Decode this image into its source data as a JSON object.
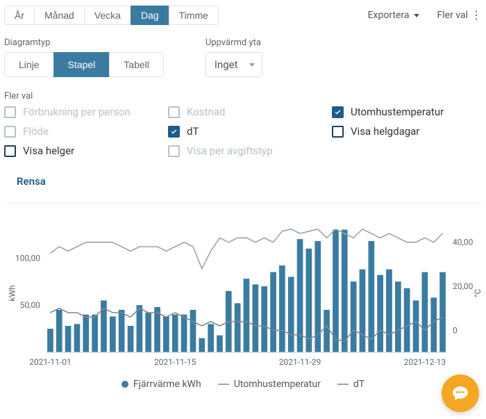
{
  "period_tabs": {
    "items": [
      "År",
      "Månad",
      "Vecka",
      "Dag",
      "Timme"
    ],
    "active": "Dag"
  },
  "actions": {
    "export": "Exportera",
    "more": "Fler val"
  },
  "chart_type": {
    "label": "Diagramtyp",
    "items": [
      "Linje",
      "Stapel",
      "Tabell"
    ],
    "active": "Stapel"
  },
  "heated_area": {
    "label": "Uppvärmd yta",
    "value": "Inget"
  },
  "more_options": {
    "label": "Fler val",
    "items": [
      {
        "label": "Förbrukning per person",
        "checked": false,
        "disabled": true
      },
      {
        "label": "Kostnad",
        "checked": false,
        "disabled": true
      },
      {
        "label": "Utomhustemperatur",
        "checked": true,
        "disabled": false
      },
      {
        "label": "Flöde",
        "checked": false,
        "disabled": true
      },
      {
        "label": "dT",
        "checked": true,
        "disabled": false
      },
      {
        "label": "Visa helgdagar",
        "checked": false,
        "disabled": false
      },
      {
        "label": "Visa helger",
        "checked": false,
        "disabled": false
      },
      {
        "label": "Visa per avgiftstyp",
        "checked": false,
        "disabled": true
      }
    ]
  },
  "clear": "Rensa",
  "axes": {
    "left_label": "kWh",
    "right_label": "°C",
    "left_ticks": [
      "50,00",
      "100,00"
    ],
    "right_ticks": [
      "0",
      "20,00",
      "40,00"
    ],
    "x_ticks": [
      "2021-11-01",
      "2021-11-15",
      "2021-11-29",
      "2021-12-13"
    ]
  },
  "legend": {
    "bar": "Fjärrvärme kWh",
    "line1": "Utomhustemperatur",
    "line2": "dT"
  },
  "colors": {
    "bar": "#3b7ba1",
    "line_light": "#9aa4ab",
    "line_mid": "#7d878e",
    "accent": "#1f5c8b",
    "fab": "#f5a623"
  },
  "chart_data": {
    "type": "bar",
    "title": "",
    "xlabel": "",
    "ylabel_left": "kWh",
    "ylabel_right": "°C",
    "ylim_left": [
      0,
      140
    ],
    "ylim_right": [
      -10,
      50
    ],
    "categories": [
      "2021-11-01",
      "2021-11-02",
      "2021-11-03",
      "2021-11-04",
      "2021-11-05",
      "2021-11-06",
      "2021-11-07",
      "2021-11-08",
      "2021-11-09",
      "2021-11-10",
      "2021-11-11",
      "2021-11-12",
      "2021-11-13",
      "2021-11-14",
      "2021-11-15",
      "2021-11-16",
      "2021-11-17",
      "2021-11-18",
      "2021-11-19",
      "2021-11-20",
      "2021-11-21",
      "2021-11-22",
      "2021-11-23",
      "2021-11-24",
      "2021-11-25",
      "2021-11-26",
      "2021-11-27",
      "2021-11-28",
      "2021-11-29",
      "2021-11-30",
      "2021-12-01",
      "2021-12-02",
      "2021-12-03",
      "2021-12-04",
      "2021-12-05",
      "2021-12-06",
      "2021-12-07",
      "2021-12-08",
      "2021-12-09",
      "2021-12-10",
      "2021-12-11",
      "2021-12-12",
      "2021-12-13",
      "2021-12-14",
      "2021-12-15"
    ],
    "series": [
      {
        "name": "Fjärrvärme kWh",
        "type": "bar",
        "axis": "left",
        "values": [
          25,
          45,
          28,
          30,
          40,
          40,
          55,
          38,
          45,
          28,
          50,
          42,
          48,
          38,
          40,
          40,
          45,
          15,
          30,
          18,
          65,
          52,
          78,
          72,
          70,
          85,
          92,
          80,
          120,
          110,
          118,
          45,
          130,
          130,
          75,
          88,
          118,
          82,
          88,
          75,
          68,
          55,
          85,
          58,
          85
        ]
      },
      {
        "name": "Utomhustemperatur",
        "type": "line",
        "axis": "right",
        "values": [
          35,
          38,
          36,
          38,
          40,
          40,
          40,
          40,
          38,
          36,
          38,
          38,
          38,
          36,
          38,
          40,
          38,
          28,
          36,
          42,
          40,
          42,
          42,
          40,
          42,
          40,
          45,
          46,
          44,
          45,
          46,
          42,
          46,
          44,
          42,
          46,
          44,
          42,
          44,
          42,
          40,
          40,
          42,
          40,
          44
        ]
      },
      {
        "name": "dT",
        "type": "line",
        "axis": "right",
        "values": [
          8,
          10,
          8,
          8,
          6,
          6,
          10,
          8,
          8,
          6,
          10,
          8,
          8,
          6,
          8,
          6,
          4,
          2,
          4,
          2,
          4,
          4,
          4,
          2,
          2,
          0,
          0,
          -2,
          -2,
          -4,
          -2,
          2,
          -4,
          -5,
          0,
          -2,
          -4,
          0,
          -2,
          0,
          2,
          4,
          0,
          4,
          6
        ]
      }
    ]
  }
}
